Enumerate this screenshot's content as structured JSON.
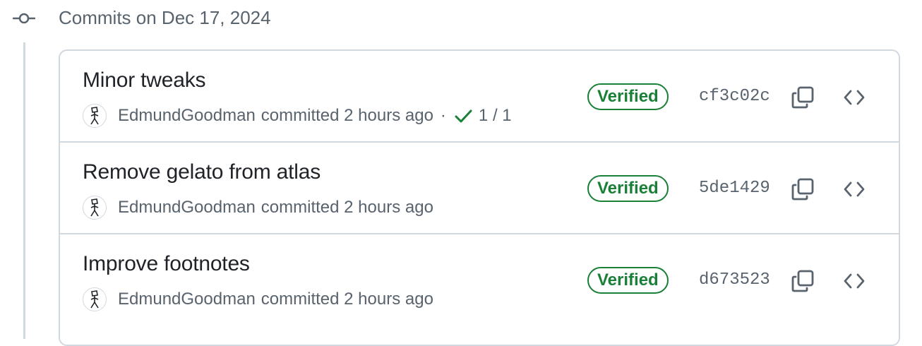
{
  "group": {
    "title": "Commits on Dec 17, 2024",
    "icon": "git-commit-icon"
  },
  "commits": [
    {
      "title": "Minor tweaks",
      "author": "EdmundGoodman",
      "committed_text": "committed 2 hours ago",
      "separator": "·",
      "checks": "1 / 1",
      "verified_label": "Verified",
      "sha": "cf3c02c"
    },
    {
      "title": "Remove gelato from atlas",
      "author": "EdmundGoodman",
      "committed_text": "committed 2 hours ago",
      "verified_label": "Verified",
      "sha": "5de1429"
    },
    {
      "title": "Improve footnotes",
      "author": "EdmundGoodman",
      "committed_text": "committed 2 hours ago",
      "verified_label": "Verified",
      "sha": "d673523"
    }
  ],
  "colors": {
    "verified": "#1a7f37",
    "muted_text": "#59636e",
    "border": "#d1d9e0",
    "text": "#1f2328"
  },
  "icons": {
    "copy": "copy-icon",
    "browse": "code-icon",
    "check": "check-icon",
    "avatar": "stick-figure-avatar"
  }
}
